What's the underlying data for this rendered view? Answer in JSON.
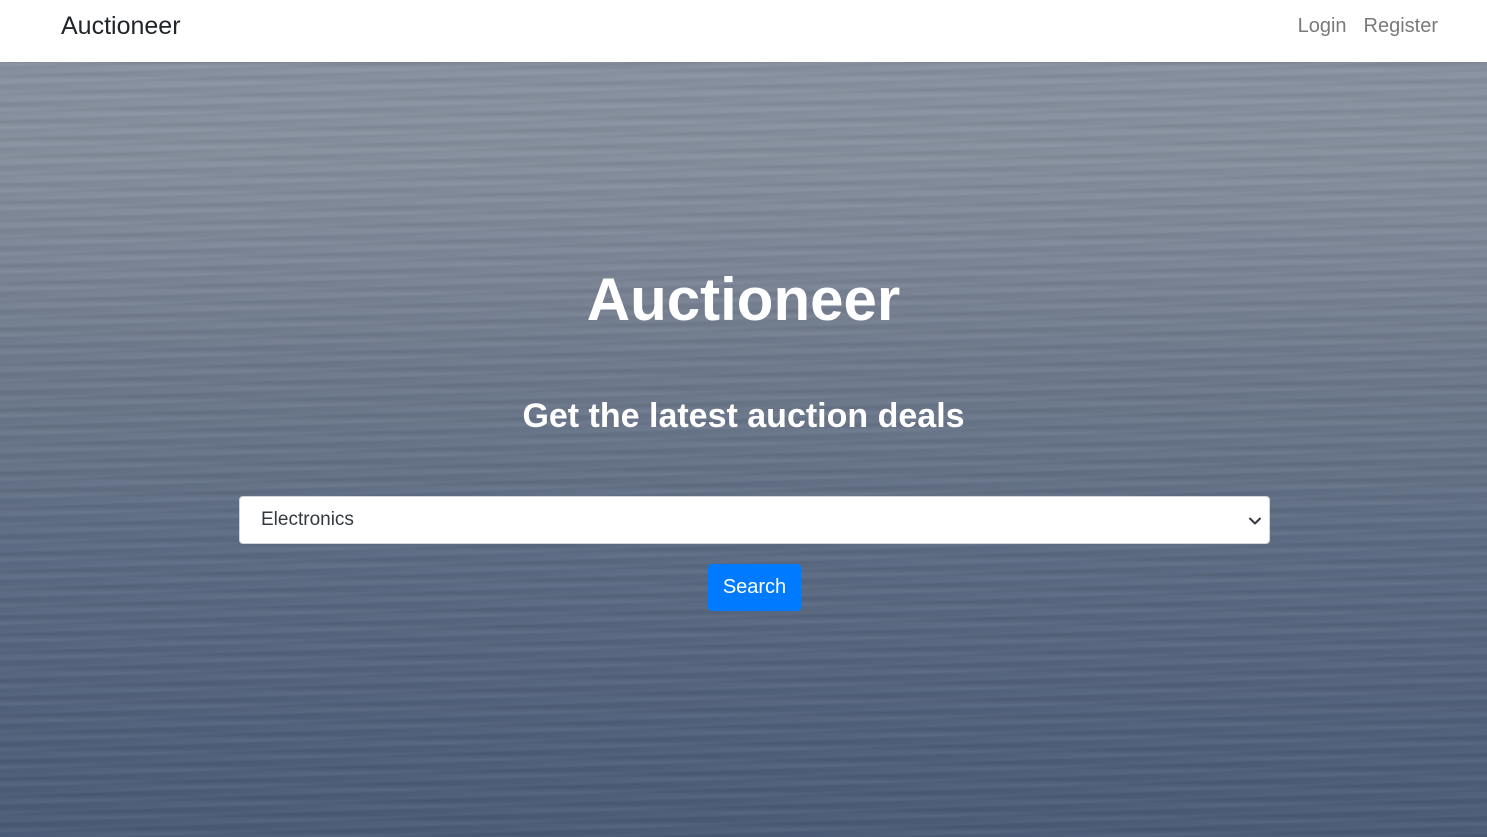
{
  "navbar": {
    "brand": "Auctioneer",
    "links": [
      {
        "label": "Login"
      },
      {
        "label": "Register"
      }
    ]
  },
  "hero": {
    "title": "Auctioneer",
    "subtitle": "Get the latest auction deals",
    "background_icon": "ocean-water-photo"
  },
  "search": {
    "category_selected": "Electronics",
    "button_label": "Search",
    "button_color": "#007bff"
  }
}
